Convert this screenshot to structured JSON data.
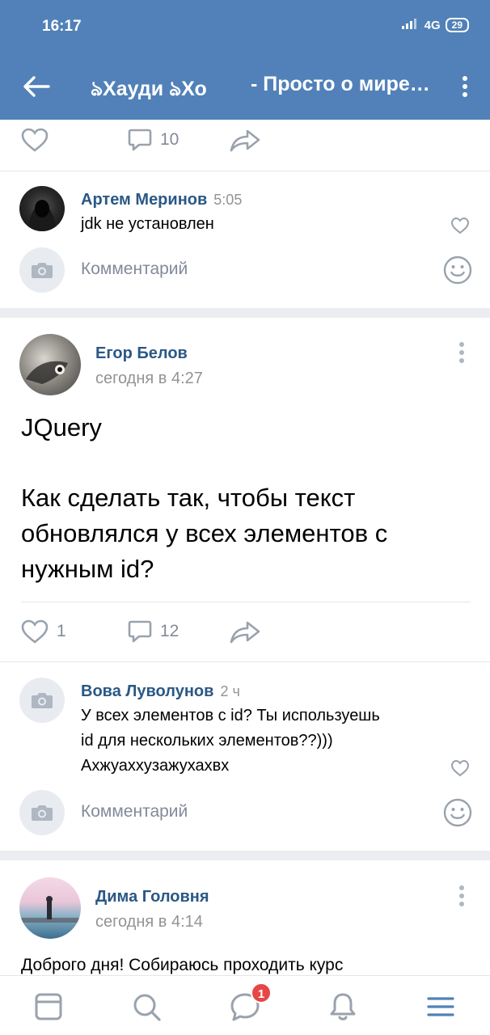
{
  "status_bar": {
    "time": "16:17",
    "network": "4G",
    "battery": "29"
  },
  "header": {
    "title_left": "ঌХауди ঌХо",
    "title_right": "- Просто о мире…"
  },
  "top_actions": {
    "comments_count": "10"
  },
  "comment1": {
    "author": "Артем Меринов",
    "time": "5:05",
    "text": "jdk не установлен"
  },
  "comment_input": {
    "placeholder": "Комментарий"
  },
  "post1": {
    "author": "Егор Белов",
    "time": "сегодня в 4:27",
    "body_line1": "JQuery",
    "body_line2": "Как сделать так, чтобы текст",
    "body_line3": "обновлялся у всех элементов с",
    "body_line4": "нужным id?",
    "likes_count": "1",
    "comments_count": "12"
  },
  "comment2": {
    "author": "Вова Луволунов",
    "time": "2 ч",
    "line1": "У всех элементов с id? Ты используешь",
    "line2": "id для нескольких элементов??)))",
    "line3": "Ахжуаххузажухахвх"
  },
  "comment_input2": {
    "placeholder": "Комментарий"
  },
  "post2": {
    "author": "Дима Головня",
    "time": "сегодня в 4:14",
    "body_line1": "Доброго дня! Собираюсь проходить курс"
  },
  "bottom_nav": {
    "messages_badge": "1"
  },
  "colors": {
    "brand": "#5181b8",
    "link": "#2a5885",
    "icon_gray": "#828a99",
    "badge": "#e64646"
  }
}
